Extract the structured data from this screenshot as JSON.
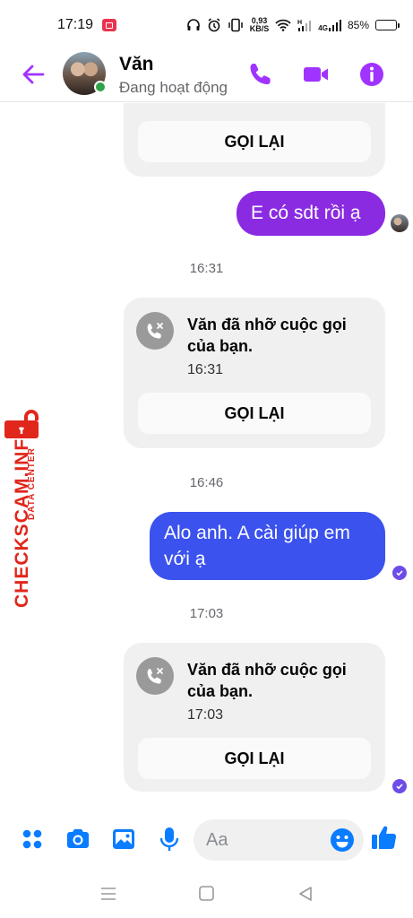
{
  "status_bar": {
    "time": "17:19",
    "net_speed_value": "0,93",
    "net_speed_unit": "KB/S",
    "network_label": "4G",
    "battery": "85%",
    "battery_level": 0.85
  },
  "header": {
    "contact_name": "Văn",
    "presence": "Đang hoạt động",
    "accent_color": "#a033ff"
  },
  "chat": {
    "top_card": {
      "callback_label": "GỌI LẠI"
    },
    "msg1": {
      "text": "E có sdt rồi ạ",
      "color": "#8a2be2"
    },
    "ts1": "16:31",
    "card1": {
      "title": "Văn đã nhỡ cuộc gọi của bạn.",
      "time": "16:31",
      "callback_label": "GỌI LẠI"
    },
    "ts2": "16:46",
    "msg2": {
      "text": "Alo anh. A cài giúp em với ạ",
      "color": "#3b52ee"
    },
    "ts3": "17:03",
    "card2": {
      "title": "Văn đã nhỡ cuộc gọi của bạn.",
      "time": "17:03",
      "callback_label": "GỌI LẠI"
    }
  },
  "watermark": {
    "main": "CHECKSCAM.INFO",
    "sub": "DATA CENTER",
    "color": "#e1261c"
  },
  "composer": {
    "placeholder": "Aa",
    "icon_color": "#0a7cff"
  },
  "icons": {
    "header": [
      "back-arrow-icon",
      "phone-icon",
      "video-camera-icon",
      "info-icon"
    ],
    "composer": [
      "apps-grid-icon",
      "camera-icon",
      "image-icon",
      "microphone-icon",
      "emoji-icon",
      "thumbs-up-icon"
    ],
    "navigation": [
      "menu-icon",
      "home-icon",
      "back-icon"
    ]
  }
}
